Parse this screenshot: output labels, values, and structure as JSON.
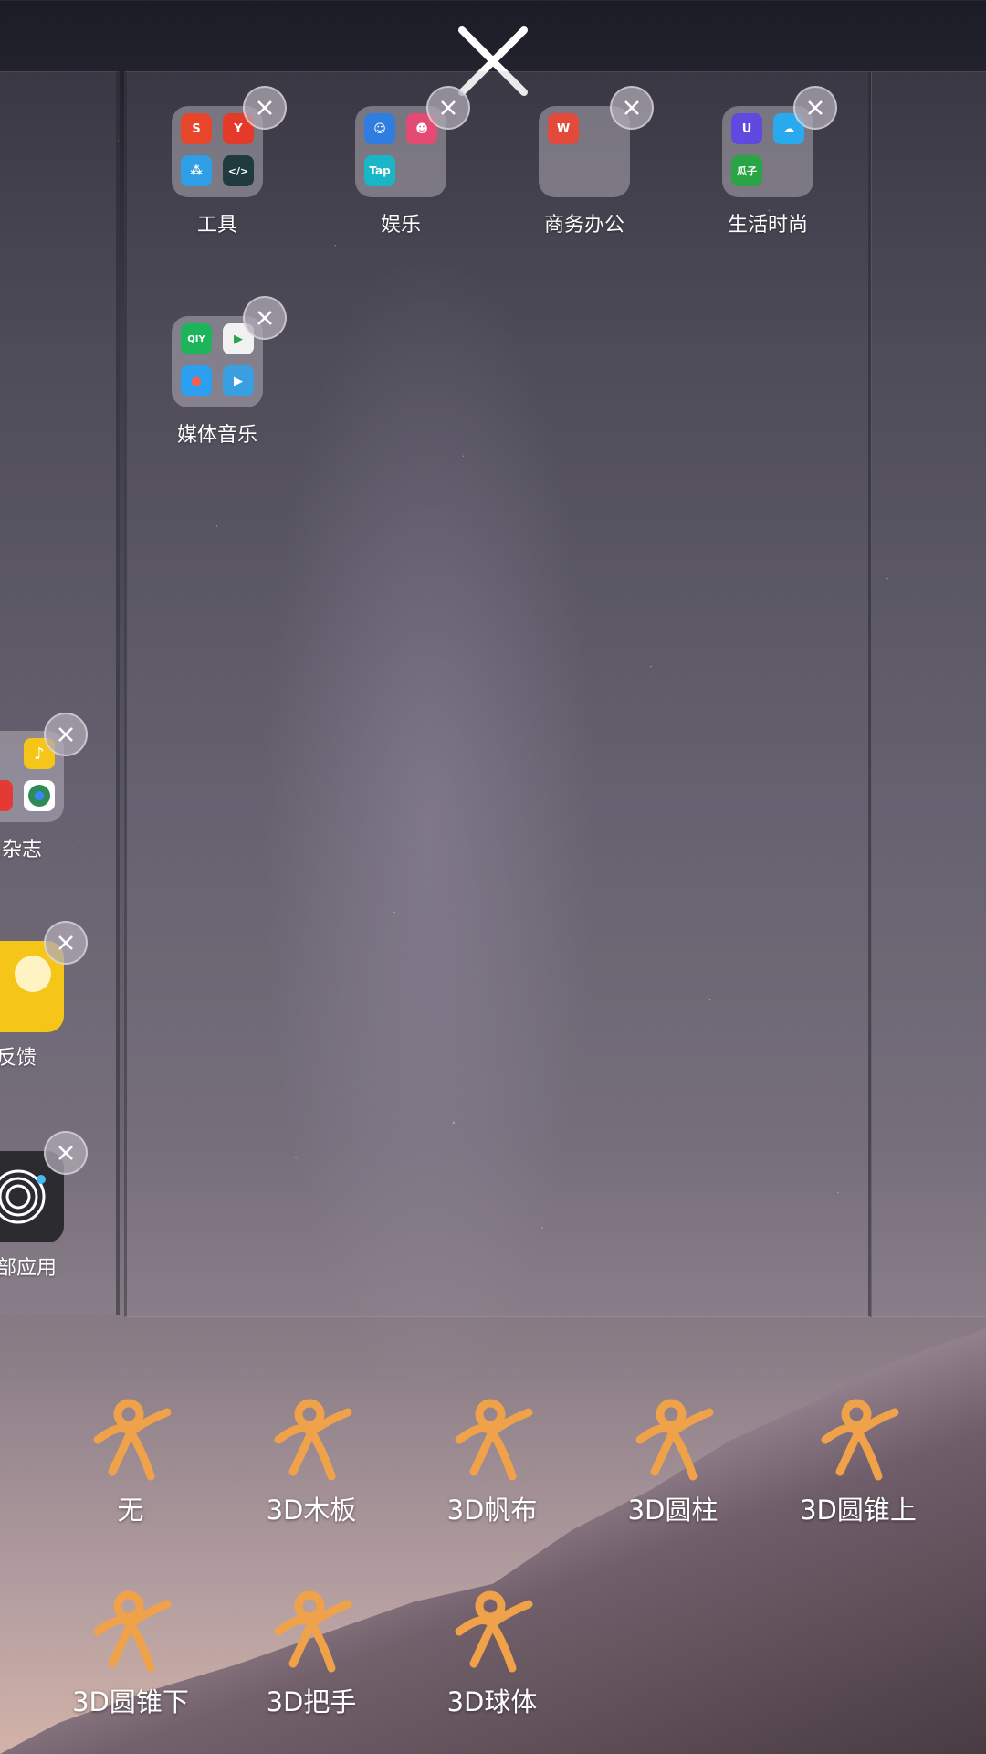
{
  "top_close": {
    "icon": "close-icon"
  },
  "folders": [
    {
      "name": "工具",
      "apps": [
        {
          "glyph": "S",
          "color": "#e8462b"
        },
        {
          "glyph": "Y",
          "color": "#e53a2a"
        },
        {
          "glyph": "⁂",
          "color": "#2e9fe6"
        },
        {
          "glyph": "</>",
          "color": "#1f3b40"
        }
      ]
    },
    {
      "name": "娱乐",
      "apps": [
        {
          "glyph": "☺",
          "color": "#2f7de1"
        },
        {
          "glyph": "☻",
          "color": "#e34a74"
        },
        {
          "glyph": "Tap",
          "color": "#19b6c8"
        },
        {
          "glyph": "",
          "color": "transparent"
        }
      ]
    },
    {
      "name": "商务办公",
      "apps": [
        {
          "glyph": "W",
          "color": "#e24a3b"
        },
        {
          "glyph": "",
          "color": "transparent"
        },
        {
          "glyph": "",
          "color": "transparent"
        },
        {
          "glyph": "",
          "color": "transparent"
        }
      ]
    },
    {
      "name": "生活时尚",
      "apps": [
        {
          "glyph": "U",
          "color": "#6049e0"
        },
        {
          "glyph": "☁",
          "color": "#29a9ee"
        },
        {
          "glyph": "瓜子",
          "color": "#2aa545"
        },
        {
          "glyph": "",
          "color": "transparent"
        }
      ]
    },
    {
      "name": "媒体音乐",
      "apps": [
        {
          "glyph": "QIY",
          "color": "#1db55c"
        },
        {
          "glyph": "▶",
          "color": "#f2f2f2"
        },
        {
          "glyph": "●",
          "color": "#2d9ff0"
        },
        {
          "glyph": "▶",
          "color": "#3a9fe0"
        }
      ]
    }
  ],
  "left_panel_items": [
    {
      "label": "闻杂志"
    },
    {
      "label": "反馈"
    },
    {
      "label": "部应用"
    }
  ],
  "effects": [
    "无",
    "3D木板",
    "3D帆布",
    "3D圆柱",
    "3D圆锥上",
    "3D圆锥下",
    "3D把手",
    "3D球体"
  ]
}
